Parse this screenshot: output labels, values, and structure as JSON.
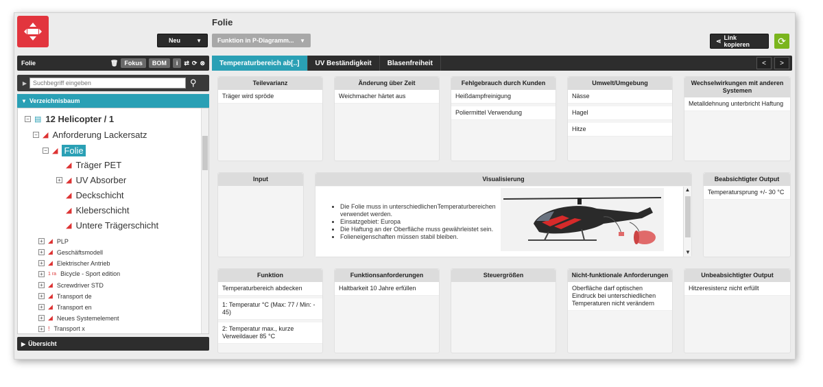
{
  "header": {
    "title": "Folie",
    "new_button": "Neu",
    "function_dropdown": "Funktion in P-Diagramm...",
    "link_button": "Link kopieren"
  },
  "left_panel": {
    "title": "Folie",
    "fokus": "Fokus",
    "bom": "BOM",
    "info": "i",
    "search_placeholder": "Suchbegriff eingeben",
    "tree_header": "Verzeichnisbaum",
    "tree": [
      {
        "label": "12 Helicopter / 1"
      },
      {
        "label": "Anforderung Lackersatz"
      },
      {
        "label": "Folie"
      },
      {
        "label": "Träger PET"
      },
      {
        "label": "UV Absorber"
      },
      {
        "label": "Deckschicht"
      },
      {
        "label": "Kleberschicht"
      },
      {
        "label": "Untere Trägerschicht"
      },
      {
        "label": "PLP"
      },
      {
        "label": "Geschäftsmodell"
      },
      {
        "label": "Elektrischer Antrieb"
      },
      {
        "label": "Bicycle - Sport edition",
        "prefix": "1 ra"
      },
      {
        "label": "Screwdriver STD"
      },
      {
        "label": "Transport de"
      },
      {
        "label": "Transport en"
      },
      {
        "label": "Neues Systemelement"
      },
      {
        "label": "Transport x"
      }
    ],
    "overview": "Übersicht"
  },
  "tabs": [
    "Temperaturbereich ab[..]",
    "UV Beständigkeit",
    "Blasenfreiheit"
  ],
  "tab_nav": {
    "prev": "<",
    "next": ">"
  },
  "cards": {
    "teilevarianz": {
      "title": "Teilevarianz",
      "items": [
        "Träger wird spröde"
      ]
    },
    "aenderung": {
      "title": "Änderung über Zeit",
      "items": [
        "Weichmacher härtet aus"
      ]
    },
    "fehlgebrauch": {
      "title": "Fehlgebrauch durch Kunden",
      "items": [
        "Heißdampfreinigung",
        "Poliermittel Verwendung"
      ]
    },
    "umwelt": {
      "title": "Umwelt/Umgebung",
      "items": [
        "Nässe",
        "Hagel",
        "Hitze"
      ]
    },
    "wechselwirkungen": {
      "title": "Wechselwirkungen mit anderen Systemen",
      "items": [
        "Metalldehnung unterbricht Haftung"
      ]
    },
    "input": {
      "title": "Input",
      "items": []
    },
    "visualisierung": {
      "title": "Visualisierung",
      "bullets": [
        "Die Folie muss in unterschiedlichenTemperaturbereichen verwendet werden.",
        "Einsatzgebiet: Europa",
        "Die Haftung an der Oberfläche muss gewährleistet sein.",
        "Folieneigenschaften müssen stabil bleiben."
      ]
    },
    "output": {
      "title": "Beabsichtigter Output",
      "items": [
        "Temperatursprung +/- 30 °C"
      ]
    },
    "funktion": {
      "title": "Funktion",
      "items": [
        "Temperaturbereich abdecken",
        "1: Temperatur °C (Max: 77 / Min: - 45)",
        "2: Temperatur max., kurze Verweildauer 85 °C"
      ]
    },
    "funktionsanforderungen": {
      "title": "Funktionsanforderungen",
      "items": [
        "Haltbarkeit 10 Jahre erfüllen"
      ]
    },
    "steuergroessen": {
      "title": "Steuergrößen",
      "items": []
    },
    "nichtfunktional": {
      "title": "Nicht-funktionale Anforderungen",
      "items": [
        "Oberfläche darf optischen Eindruck bei unterschiedlichen Temperaturen nicht verändern"
      ]
    },
    "unbeabsichtigt": {
      "title": "Unbeabsichtigter Output",
      "items": [
        "Hitzeresistenz nicht erfüllt"
      ]
    }
  },
  "colors": {
    "accent": "#2aa0b5",
    "brand": "#e2353e",
    "green": "#7ab51d"
  }
}
